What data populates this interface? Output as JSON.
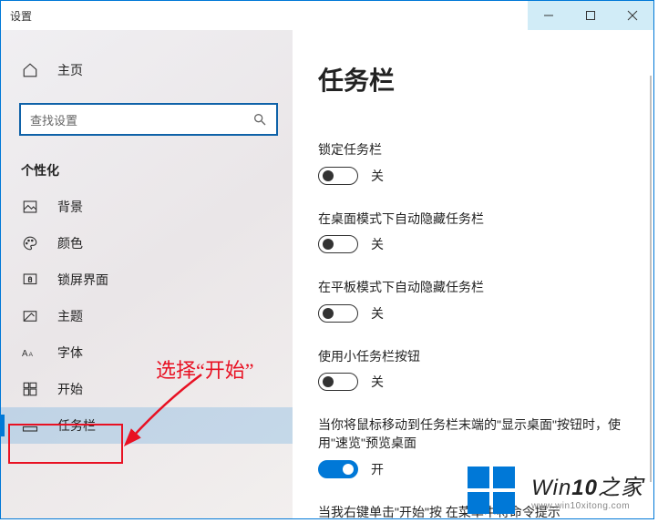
{
  "window": {
    "title": "设置"
  },
  "sidebar": {
    "home": "主页",
    "search_placeholder": "查找设置",
    "section": "个性化",
    "items": [
      {
        "label": "背景"
      },
      {
        "label": "颜色"
      },
      {
        "label": "锁屏界面"
      },
      {
        "label": "主题"
      },
      {
        "label": "字体"
      },
      {
        "label": "开始"
      },
      {
        "label": "任务栏"
      }
    ]
  },
  "annotation": {
    "text": "选择“开始”"
  },
  "main": {
    "heading": "任务栏",
    "settings": [
      {
        "label": "锁定任务栏",
        "state": "关",
        "on": false
      },
      {
        "label": "在桌面模式下自动隐藏任务栏",
        "state": "关",
        "on": false
      },
      {
        "label": "在平板模式下自动隐藏任务栏",
        "state": "关",
        "on": false
      },
      {
        "label": "使用小任务栏按钮",
        "state": "关",
        "on": false
      },
      {
        "label": "当你将鼠标移动到任务栏末端的\"显示桌面\"按钮时，使用\"速览\"预览桌面",
        "state": "开",
        "on": true
      }
    ],
    "truncated": "当我右键单击\"开始\"按 在菜单中将命令提示"
  },
  "watermark": {
    "brand_prefix": "Win",
    "brand_num": "10",
    "brand_suffix": "之家",
    "url": "www.win10xitong.com"
  }
}
